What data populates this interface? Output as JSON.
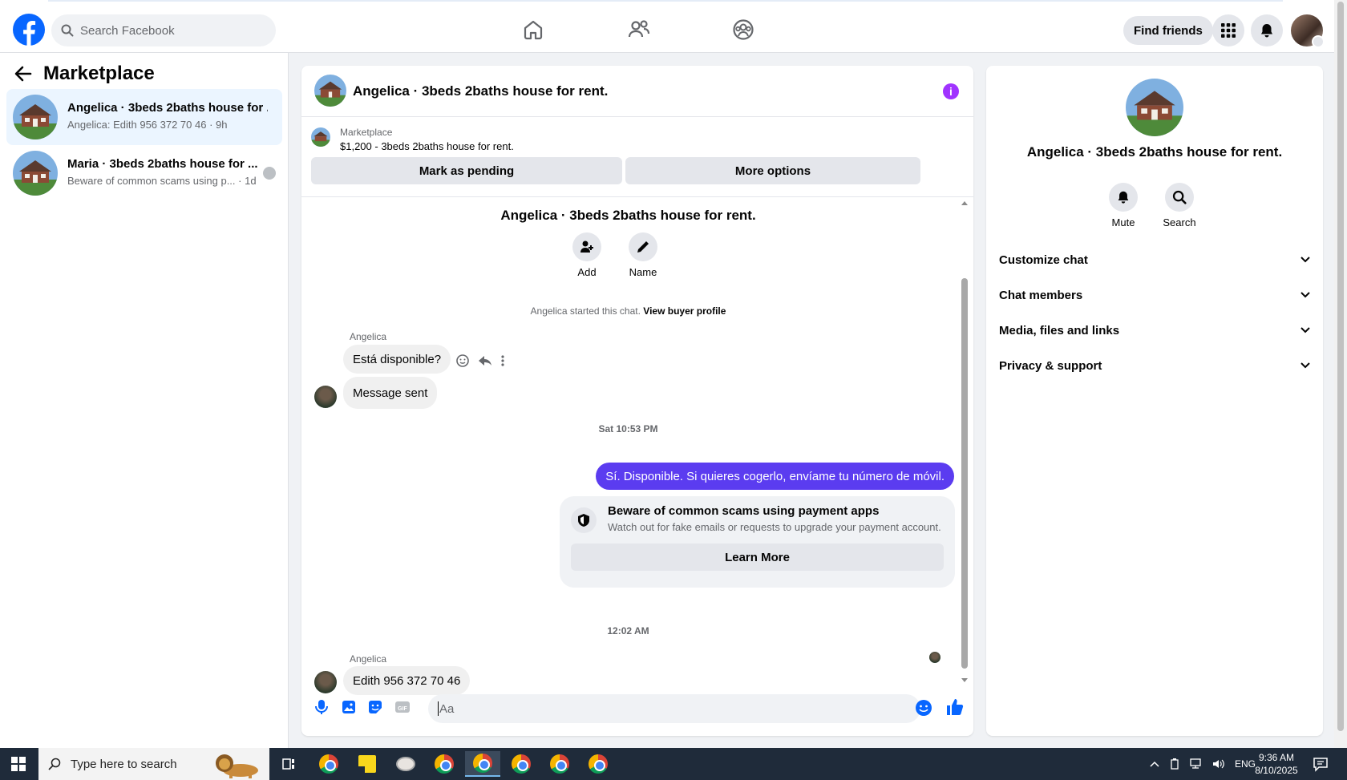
{
  "topbar": {
    "search_placeholder": "Search Facebook",
    "find_friends": "Find friends",
    "icons": [
      "facebook-logo",
      "search-icon",
      "home-icon",
      "friends-icon",
      "groups-icon",
      "menu-grid-icon",
      "bell-icon",
      "profile-avatar"
    ]
  },
  "sidebar": {
    "title": "Marketplace",
    "conversations": [
      {
        "title": "Angelica · 3beds 2baths house for ...",
        "preview": "Angelica: Edith 956 372 70 46",
        "time": "9h"
      },
      {
        "title": "Maria · 3beds 2baths house for ...",
        "preview": "Beware of common scams using p...",
        "time": "1d"
      }
    ]
  },
  "chat": {
    "header_title": "Angelica · 3beds 2baths house for rent.",
    "listing_source": "Marketplace",
    "listing_text": "$1,200 - 3beds 2baths house for rent.",
    "mark_pending": "Mark as pending",
    "more_options": "More options",
    "thread_title": "Angelica · 3beds 2baths house for rent.",
    "actions": {
      "add": "Add",
      "name": "Name"
    },
    "started_text": "Angelica started this chat.",
    "view_buyer": "View buyer profile",
    "sender_name_1": "Angelica",
    "msg_1": "Está disponible?",
    "msg_2": "Message sent",
    "time_1": "Sat 10:53 PM",
    "outgoing_1": "Sí. Disponible. Si quieres cogerlo, envíame tu número de móvil.",
    "scam_title": "Beware of common scams using payment apps",
    "scam_sub": "Watch out for fake emails or requests to upgrade your payment account.",
    "learn_more": "Learn More",
    "time_2": "12:02 AM",
    "sender_name_2": "Angelica",
    "msg_3": "Edith 956 372 70 46",
    "composer_placeholder": "Aa",
    "accent": "#5b3cf0"
  },
  "right_panel": {
    "name": "Angelica · 3beds 2baths house for rent.",
    "mute": "Mute",
    "search": "Search",
    "sections": [
      "Customize chat",
      "Chat members",
      "Media, files and links",
      "Privacy & support"
    ]
  },
  "taskbar": {
    "search_placeholder": "Type here to search",
    "lang": "ENG",
    "time": "9:36 AM",
    "date": "8/10/2025"
  }
}
